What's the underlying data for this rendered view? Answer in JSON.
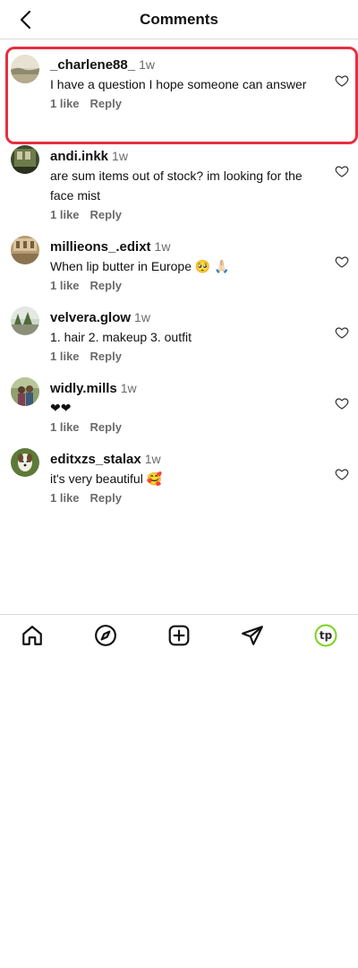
{
  "header": {
    "title": "Comments",
    "back_icon": "chevron-left-icon"
  },
  "comments": [
    {
      "username": "_charlene88_",
      "time": "1w",
      "text": "I have a question I hope someone can answer",
      "likes": "1 like",
      "reply": "Reply"
    },
    {
      "username": "andi.inkk",
      "time": "1w",
      "text": "are sum items out of stock? im looking for the face mist",
      "likes": "1 like",
      "reply": "Reply"
    },
    {
      "username": "millieons_.edixt",
      "time": "1w",
      "text": "When lip butter in Europe 🥺 🙏🏻",
      "likes": "1 like",
      "reply": "Reply"
    },
    {
      "username": "velvera.glow",
      "time": "1w",
      "text": "1. hair 2. makeup 3. outfit",
      "likes": "1 like",
      "reply": "Reply"
    },
    {
      "username": "widly.mills",
      "time": "1w",
      "text": "❤❤",
      "likes": "1 like",
      "reply": "Reply"
    },
    {
      "username": "editxzs_stalax",
      "time": "1w",
      "text": "it's very beautiful 🥰",
      "likes": "1 like",
      "reply": "Reply"
    }
  ],
  "tabbar": {
    "items": [
      "home-icon",
      "explore-compass-icon",
      "create-plus-icon",
      "send-message-icon",
      "profile-avatar"
    ],
    "profile_label": "tp",
    "accent": "#7ed321"
  },
  "colors": {
    "highlight": "#e5303f",
    "secondary_text": "#6b6b6b"
  }
}
